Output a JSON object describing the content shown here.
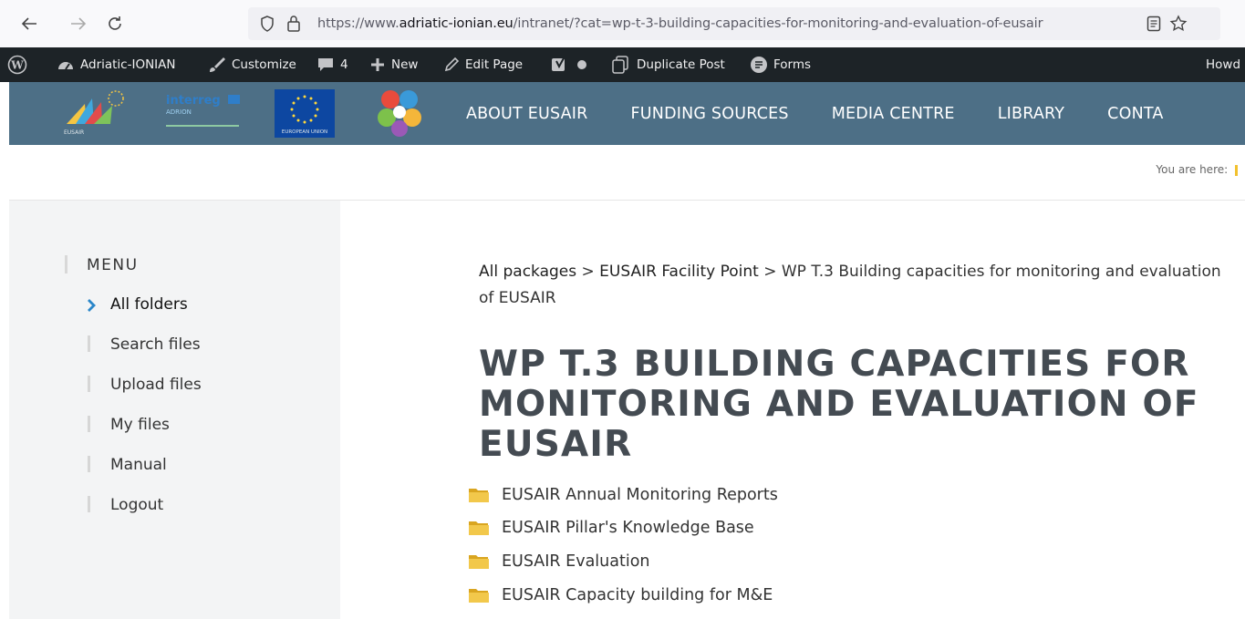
{
  "browser": {
    "url_prefix": "https://www.",
    "url_domain": "adriatic-ionian.eu",
    "url_path": "/intranet/?cat=wp-t-3-building-capacities-for-monitoring-and-evaluation-of-eusair"
  },
  "admin_bar": {
    "site_name": "Adriatic-IONIAN",
    "customize": "Customize",
    "comments_count": "4",
    "new": "New",
    "edit_page": "Edit Page",
    "duplicate_post": "Duplicate Post",
    "forms": "Forms",
    "howdy": "Howd"
  },
  "nav": {
    "items": [
      "ABOUT EUSAIR",
      "FUNDING SOURCES",
      "MEDIA CENTRE",
      "LIBRARY",
      "CONTA"
    ]
  },
  "logos": {
    "eusair": "EUSAIR",
    "interreg": "interreg",
    "adrion": "ADRION",
    "eu": "EUROPEAN UNION"
  },
  "you_are_here": "You are here:",
  "sidebar": {
    "heading": "MENU",
    "items": [
      "All folders",
      "Search files",
      "Upload files",
      "My files",
      "Manual",
      "Logout"
    ]
  },
  "path": {
    "root": "All packages",
    "sep": ">",
    "parent": "EUSAIR Facility Point",
    "current": "WP T.3 Building capacities for monitoring and evaluation of EUSAIR"
  },
  "title": "WP T.3 BUILDING CAPACITIES FOR MONITORING AND EVALUATION OF EUSAIR",
  "folders": [
    "EUSAIR Annual Monitoring Reports",
    "EUSAIR Pillar's Knowledge Base",
    "EUSAIR Evaluation",
    "EUSAIR Capacity building for M&E"
  ],
  "colors": {
    "header_bg": "#4d6f86",
    "admin_bg": "#1d2327",
    "sidebar_bg": "#f3f4f5",
    "accent": "#2a86c9",
    "folder": "#e8b92a"
  }
}
